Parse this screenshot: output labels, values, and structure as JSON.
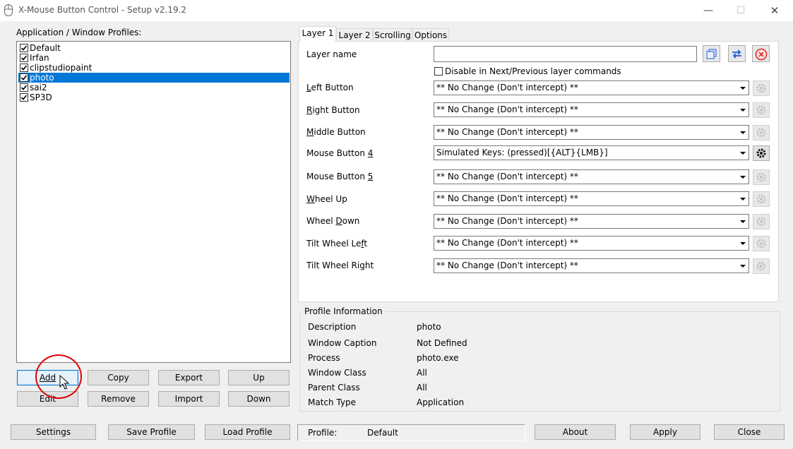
{
  "window": {
    "title": "X-Mouse Button Control - Setup v2.19.2"
  },
  "profiles": {
    "heading": "Application / Window Profiles:",
    "items": [
      {
        "label": "Default",
        "checked": true,
        "selected": false
      },
      {
        "label": "Irfan",
        "checked": true,
        "selected": false
      },
      {
        "label": "clipstudiopaint",
        "checked": true,
        "selected": false
      },
      {
        "label": "photo",
        "checked": true,
        "selected": true
      },
      {
        "label": "sai2",
        "checked": true,
        "selected": false
      },
      {
        "label": "SP3D",
        "checked": true,
        "selected": false
      }
    ],
    "buttons": {
      "add": "Add",
      "copy": "Copy",
      "export": "Export",
      "up": "Up",
      "edit": "Edit",
      "remove": "Remove",
      "import": "Import",
      "down": "Down"
    }
  },
  "tabs": [
    {
      "label": "Layer 1",
      "active": true
    },
    {
      "label": "Layer 2",
      "active": false
    },
    {
      "label": "Scrolling",
      "active": false
    },
    {
      "label": "Options",
      "active": false
    }
  ],
  "layer": {
    "name_label": "Layer name",
    "name_value": "",
    "disable_label": "Disable in Next/Previous layer commands",
    "disable_checked": false,
    "rows": [
      {
        "label": "Left Button",
        "value": "** No Change (Don't intercept) **",
        "gear_enabled": false
      },
      {
        "label": "Right Button",
        "value": "** No Change (Don't intercept) **",
        "gear_enabled": false
      },
      {
        "label": "Middle Button",
        "value": "** No Change (Don't intercept) **",
        "gear_enabled": false
      },
      {
        "label": "Mouse Button 4",
        "value": "Simulated Keys: (pressed)[{ALT}{LMB}]",
        "gear_enabled": true
      },
      {
        "label": "Mouse Button 5",
        "value": "** No Change (Don't intercept) **",
        "gear_enabled": false
      },
      {
        "label": "Wheel Up",
        "value": "** No Change (Don't intercept) **",
        "gear_enabled": false
      },
      {
        "label": "Wheel Down",
        "value": "** No Change (Don't intercept) **",
        "gear_enabled": false
      },
      {
        "label": "Tilt Wheel Left",
        "value": "** No Change (Don't intercept) **",
        "gear_enabled": false
      },
      {
        "label": "Tilt Wheel Right",
        "value": "** No Change (Don't intercept) **",
        "gear_enabled": false
      }
    ]
  },
  "profile_info": {
    "heading": "Profile Information",
    "rows": [
      {
        "label": "Description",
        "value": "photo"
      },
      {
        "label": "Window Caption",
        "value": "Not Defined"
      },
      {
        "label": "Process",
        "value": "photo.exe"
      },
      {
        "label": "Window Class",
        "value": "All"
      },
      {
        "label": "Parent Class",
        "value": "All"
      },
      {
        "label": "Match Type",
        "value": "Application"
      }
    ]
  },
  "bottom": {
    "settings": "Settings",
    "save_profile": "Save Profile",
    "load_profile": "Load Profile",
    "profile_label": "Profile:",
    "profile_value": "Default",
    "about": "About",
    "apply": "Apply",
    "close": "Close"
  },
  "colors": {
    "selection": "#0078d7",
    "annotation_circle": "#e00000"
  }
}
